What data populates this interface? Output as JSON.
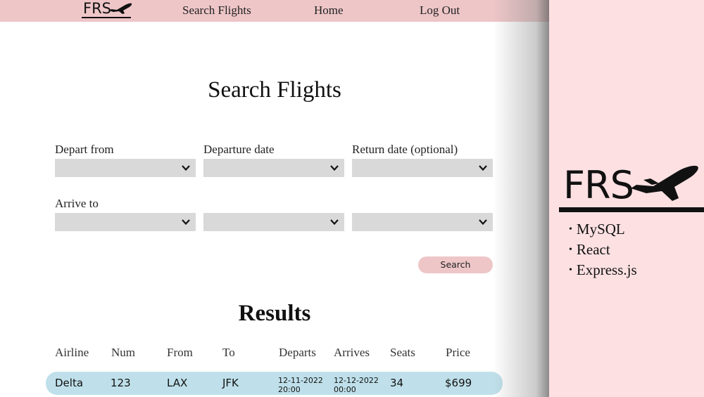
{
  "nav": {
    "logo_text": "FRS",
    "links": [
      "Search Flights",
      "Home",
      "Log Out"
    ]
  },
  "page_title": "Search Flights",
  "form": {
    "depart_label": "Depart from",
    "departure_date_label": "Departure date",
    "return_date_label": "Return date (optional)",
    "arrive_label": "Arrive to",
    "search_button": "Search"
  },
  "results": {
    "title": "Results",
    "columns": [
      "Airline",
      "Num",
      "From",
      "To",
      "Departs",
      "Arrives",
      "Seats",
      "Price"
    ],
    "rows": [
      {
        "airline": "Delta",
        "num": "123",
        "from": "LAX",
        "to": "JFK",
        "departs_date": "12-11-2022",
        "departs_time": "20:00",
        "arrives_date": "12-12-2022",
        "arrives_time": "00:00",
        "seats": "34",
        "price": "$699"
      }
    ]
  },
  "side": {
    "logo_text": "FRS",
    "tech": [
      "MySQL",
      "React",
      "Express.js"
    ]
  },
  "colors": {
    "nav_bg": "#eec6c8",
    "side_bg": "#fde0e2",
    "select_bg": "#d9d9d9",
    "row_bg": "#bfe0ea"
  },
  "icons": [
    "airplane-icon",
    "chevron-down-icon"
  ]
}
